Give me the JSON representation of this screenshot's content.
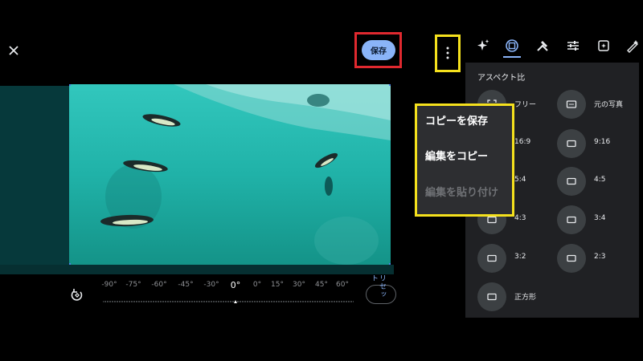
{
  "toolbar": {
    "save_label": "保存"
  },
  "tool_tabs": [
    "auto-enhance-icon",
    "crop-rotate-icon",
    "tools-icon",
    "adjust-icon",
    "filters-icon",
    "markup-icon"
  ],
  "crop_panel": {
    "section_title": "アスペクト比",
    "aspect_ratios": [
      {
        "label": "フリー",
        "icon": "free-crop-icon"
      },
      {
        "label": "元の写真",
        "icon": "original-ratio-icon"
      },
      {
        "label": "16:9",
        "icon": "ratio-icon"
      },
      {
        "label": "9:16",
        "icon": "ratio-icon"
      },
      {
        "label": "5:4",
        "icon": "ratio-icon"
      },
      {
        "label": "4:5",
        "icon": "ratio-icon"
      },
      {
        "label": "4:3",
        "icon": "ratio-icon"
      },
      {
        "label": "3:4",
        "icon": "ratio-icon"
      },
      {
        "label": "3:2",
        "icon": "ratio-icon"
      },
      {
        "label": "2:3",
        "icon": "ratio-icon"
      },
      {
        "label": "正方形",
        "icon": "ratio-icon"
      }
    ]
  },
  "context_menu": {
    "items": [
      {
        "label": "コピーを保存",
        "enabled": true
      },
      {
        "label": "編集をコピー",
        "enabled": true
      },
      {
        "label": "編集を貼り付け",
        "enabled": false
      }
    ]
  },
  "angle_bar": {
    "labels": [
      "-90°",
      "-75°",
      "-60°",
      "-45°",
      "-30°",
      "0°",
      "0°",
      "15°",
      "30°",
      "45°",
      "60°"
    ],
    "current_label": "0°",
    "reset_label": "リセット"
  },
  "colors": {
    "accent": "#8ab4f8",
    "highlight_red": "#e0292f",
    "highlight_yellow": "#f5e11d",
    "panel_bg": "#202124"
  }
}
